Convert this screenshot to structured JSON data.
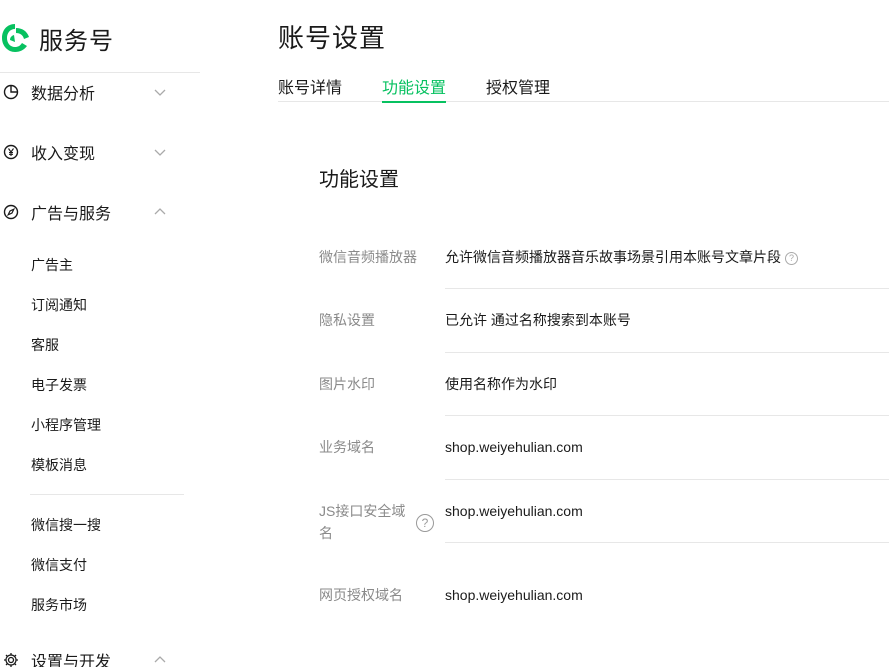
{
  "brand": {
    "name": "服务号",
    "accent": "#07c160"
  },
  "sidebar": {
    "groups": [
      {
        "label": "数据分析",
        "icon": "pie-chart-icon",
        "expanded": false
      },
      {
        "label": "收入变现",
        "icon": "yen-icon",
        "expanded": false
      },
      {
        "label": "广告与服务",
        "icon": "compass-icon",
        "expanded": true
      },
      {
        "label": "设置与开发",
        "icon": "gear-icon",
        "expanded": true
      }
    ],
    "items": [
      "广告主",
      "订阅通知",
      "客服",
      "电子发票",
      "小程序管理",
      "模板消息",
      "微信搜一搜",
      "微信支付",
      "服务市场"
    ]
  },
  "header": {
    "title": "账号设置",
    "tabs": [
      {
        "label": "账号详情",
        "active": false
      },
      {
        "label": "功能设置",
        "active": true
      },
      {
        "label": "授权管理",
        "active": false
      }
    ]
  },
  "card": {
    "title": "功能设置",
    "rows": [
      {
        "label": "微信音频播放器",
        "value": "允许微信音频播放器音乐故事场景引用本账号文章片段"
      },
      {
        "label": "隐私设置",
        "value": "已允许 通过名称搜索到本账号"
      },
      {
        "label": "图片水印",
        "value": "使用名称作为水印"
      },
      {
        "label": "业务域名",
        "value": "shop.weiyehulian.com"
      },
      {
        "label": "JS接口安全域名",
        "value": "shop.weiyehulian.com"
      },
      {
        "label": "网页授权域名",
        "value": "shop.weiyehulian.com"
      }
    ]
  },
  "help_glyph": "?"
}
